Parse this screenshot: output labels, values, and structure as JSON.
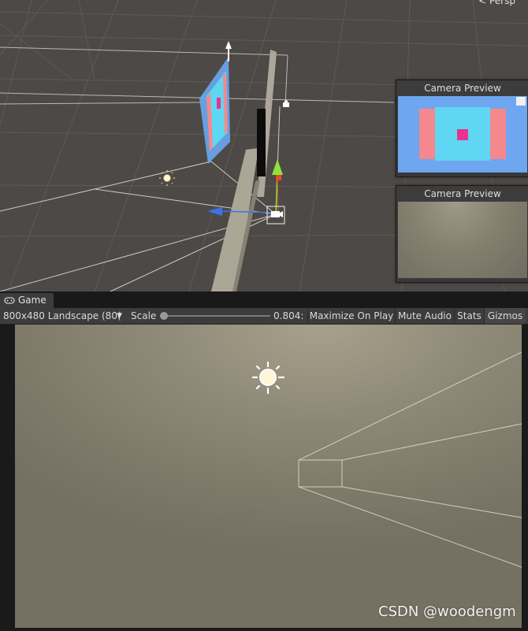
{
  "scene": {
    "projection_label": "< Persp"
  },
  "camera_previews": [
    {
      "title": "Camera Preview"
    },
    {
      "title": "Camera Preview"
    }
  ],
  "game_panel": {
    "tab_label": "Game",
    "tab_icon": "gamepad-icon",
    "resolution": "800x480 Landscape (80(",
    "scale_label": "Scale",
    "scale_value": "0.804:",
    "maximize_label": "Maximize On Play",
    "mute_label": "Mute Audio",
    "stats_label": "Stats",
    "gizmos_label": "Gizmos"
  },
  "icons": {
    "light": "sun-light-icon",
    "camera": "camera-gizmo-icon",
    "tab_menu": "kebab-menu-icon"
  },
  "colors": {
    "preview_sky": "#6ea6ef",
    "quad_pink": "#f5888c",
    "quad_cyan": "#5fd6f2",
    "quad_magenta": "#e8348e",
    "gizmo_green": "#8ee23a",
    "gizmo_blue": "#3a74e8",
    "gizmo_red": "#e8492a"
  },
  "watermark": "CSDN @woodengm"
}
